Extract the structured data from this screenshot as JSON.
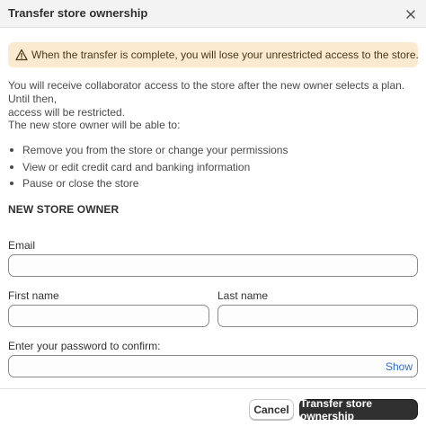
{
  "dialog": {
    "title": "Transfer store ownership",
    "close_label": "Close"
  },
  "banner": {
    "text": "When the transfer is complete, you will lose your unrestricted access to the store.",
    "icon": "alert-triangle-icon",
    "background": "#fbead0"
  },
  "info": {
    "paragraph1_line1": "You will receive collaborator access to the store after the new owner selects a plan. Until then,",
    "paragraph1_line2": "access will be restricted.",
    "paragraph2": "The new store owner will be able to:",
    "capabilities": [
      "Remove you from the store or change your permissions",
      "View or edit credit card and banking information",
      "Pause or close the store"
    ]
  },
  "form": {
    "section_title": "NEW STORE OWNER",
    "email": {
      "label": "Email",
      "value": ""
    },
    "first_name": {
      "label": "First name",
      "value": ""
    },
    "last_name": {
      "label": "Last name",
      "value": ""
    },
    "password": {
      "label": "Enter your password to confirm:",
      "value": "",
      "show_label": "Show"
    }
  },
  "footer": {
    "cancel_label": "Cancel",
    "submit_label": "Transfer store ownership"
  },
  "colors": {
    "primary_button": "#303030",
    "link": "#2c6ecb",
    "warning_bg": "#fbead0"
  }
}
